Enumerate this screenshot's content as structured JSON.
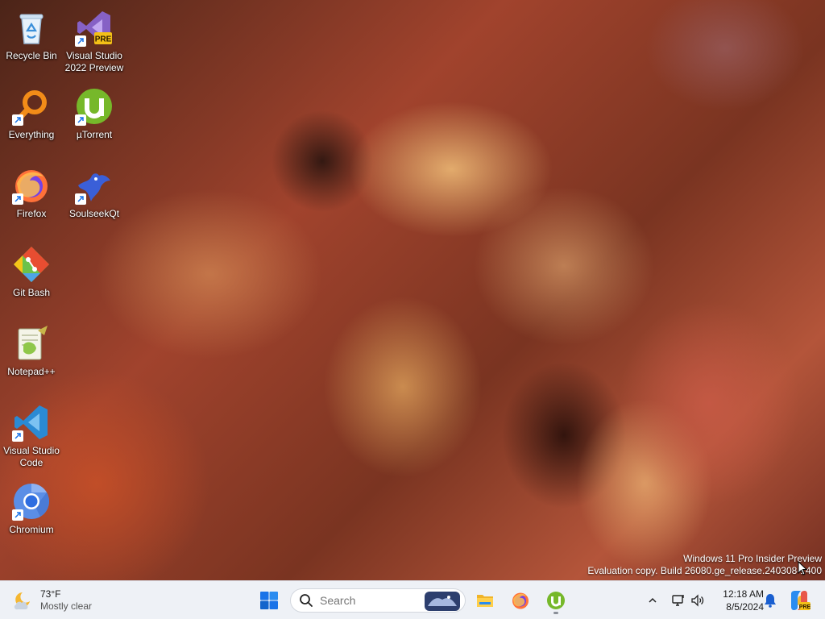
{
  "desktop_icons": [
    {
      "label": "Recycle Bin",
      "icon": "recycle-bin-icon"
    },
    {
      "label": "Visual Studio 2022 Preview",
      "icon": "visual-studio-preview-icon",
      "badge": "PRE"
    },
    {
      "label": "Everything",
      "icon": "everything-search-icon"
    },
    {
      "label": "µTorrent",
      "icon": "utorrent-icon"
    },
    {
      "label": "Firefox",
      "icon": "firefox-icon"
    },
    {
      "label": "SoulseekQt",
      "icon": "soulseek-icon"
    },
    {
      "label": "Git Bash",
      "icon": "git-bash-icon"
    },
    {
      "label": "Notepad++",
      "icon": "notepad-plus-plus-icon"
    },
    {
      "label": "Visual Studio Code",
      "icon": "vscode-icon"
    },
    {
      "label": "Chromium",
      "icon": "chromium-icon"
    }
  ],
  "watermark": {
    "line1": "Windows 11 Pro Insider Preview",
    "line2": "Evaluation copy. Build 26080.ge_release.240308-1400"
  },
  "taskbar": {
    "weather": {
      "temp": "73°F",
      "condition": "Mostly clear"
    },
    "search": {
      "placeholder": "Search"
    },
    "pinned": [
      "start-icon",
      "file-explorer-icon",
      "firefox-icon",
      "utorrent-icon"
    ],
    "clock": {
      "time": "12:18 AM",
      "date": "8/5/2024"
    }
  },
  "colors": {
    "taskbar_bg": "#eef1f6",
    "start_blue": "#1a73e8",
    "utorrent_green": "#76b82a",
    "vscode_blue": "#2a8ad4"
  }
}
